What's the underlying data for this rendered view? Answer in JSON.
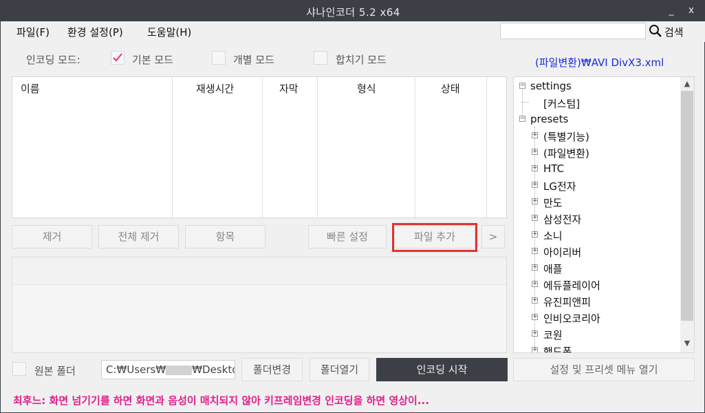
{
  "window": {
    "title": "샤나인코더  5.2 x64",
    "minimize": "_",
    "close": "x"
  },
  "menu": {
    "items": [
      "파일(F)",
      "환경 설정(P)",
      "도움말(H)"
    ],
    "search_label": "검색",
    "search_value": ""
  },
  "encoding_mode": {
    "label": "인코딩 모드:",
    "options": [
      {
        "label": "기본 모드",
        "checked": true
      },
      {
        "label": "개별 모드",
        "checked": false
      },
      {
        "label": "합치기 모드",
        "checked": false
      }
    ]
  },
  "preset_name": "(파일변환)₩AVI DivX3.xml",
  "file_list": {
    "columns": [
      "이름",
      "재생시간",
      "자막",
      "형식",
      "상태"
    ]
  },
  "buttons": {
    "remove": "제거",
    "remove_all": "전체 제거",
    "items": "항목",
    "quick_settings": "빠른 설정",
    "add_file": "파일 추가",
    "more": ">"
  },
  "tree": {
    "settings": "settings",
    "custom": "[커스텀]",
    "presets": "presets",
    "items": [
      "(특별기능)",
      "(파일변환)",
      "HTC",
      "LG전자",
      "만도",
      "삼성전자",
      "소니",
      "아이리버",
      "애플",
      "에듀플레이어",
      "유진피앤피",
      "인비오코리아",
      "코원",
      "핸드폰"
    ]
  },
  "bottom": {
    "original_folder_label": "원본 폴더",
    "original_folder_checked": false,
    "path_prefix": "C:₩Users₩",
    "path_suffix": "₩Desktop",
    "change_folder": "폴더변경",
    "open_folder": "폴더열기",
    "start_encoding": "인코딩 시작",
    "open_settings": "설정 및 프리셋 메뉴 열기"
  },
  "tip": "최후느: 화면 넘기기를 하면 화면과 음성이 매치되지 않아 키프레임변경 인코딩을 하면 영상이...",
  "colors": {
    "titlebar": "#3d3f47",
    "preset_text": "#1a2ae0",
    "tip_text": "#e0208a",
    "highlight": "#e53030",
    "check": "#e0308a"
  }
}
